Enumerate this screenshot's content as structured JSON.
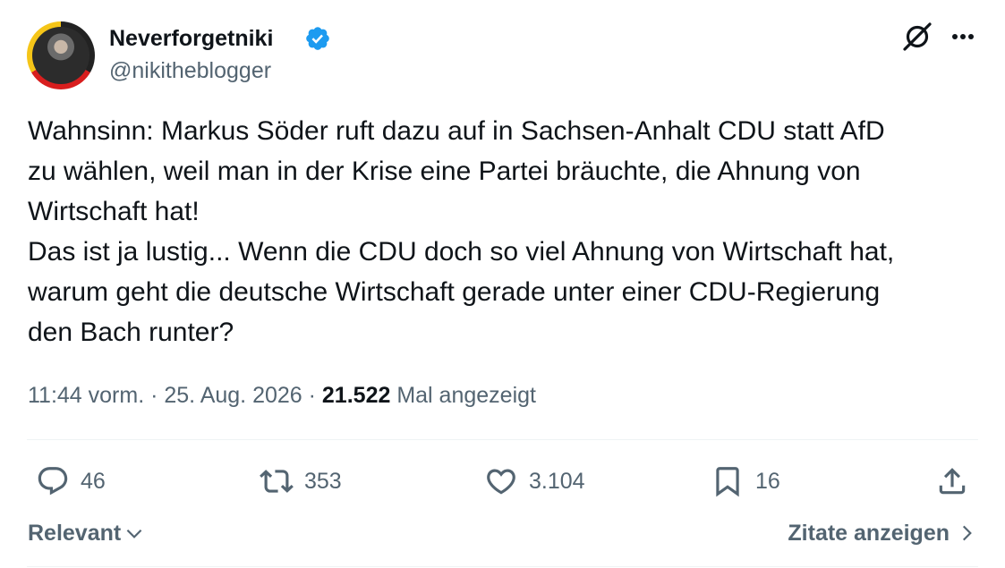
{
  "author": {
    "display_name": "Neverforgetniki",
    "handle": "@nikitheblogger",
    "verified": true,
    "verified_color": "#1d9bf0"
  },
  "header_icons": {
    "grok": "grok-icon",
    "more": "more-icon"
  },
  "tweet": {
    "lines": [
      "Wahnsinn: Markus Söder ruft dazu auf in Sachsen-Anhalt CDU statt AfD",
      "zu wählen, weil man in der Krise eine Partei bräuchte, die Ahnung von",
      "Wirtschaft hat!",
      "Das ist ja lustig... Wenn die CDU doch so viel Ahnung von Wirtschaft hat,",
      "warum geht die deutsche Wirtschaft gerade unter einer CDU-Regierung",
      "den Bach runter?"
    ]
  },
  "meta": {
    "time": "11:44 vorm.",
    "separator": " · ",
    "date": "25. Aug. 2026",
    "views_count": "21.522",
    "views_label": " Mal angezeigt"
  },
  "actions": {
    "replies": "46",
    "reposts": "353",
    "likes": "3.104",
    "bookmarks": "16"
  },
  "footer": {
    "sort_label": "Relevant",
    "quotes_label": "Zitate anzeigen"
  },
  "colors": {
    "text": "#0f1419",
    "secondary": "#536471",
    "divider": "#eff3f4",
    "accent": "#1d9bf0"
  }
}
